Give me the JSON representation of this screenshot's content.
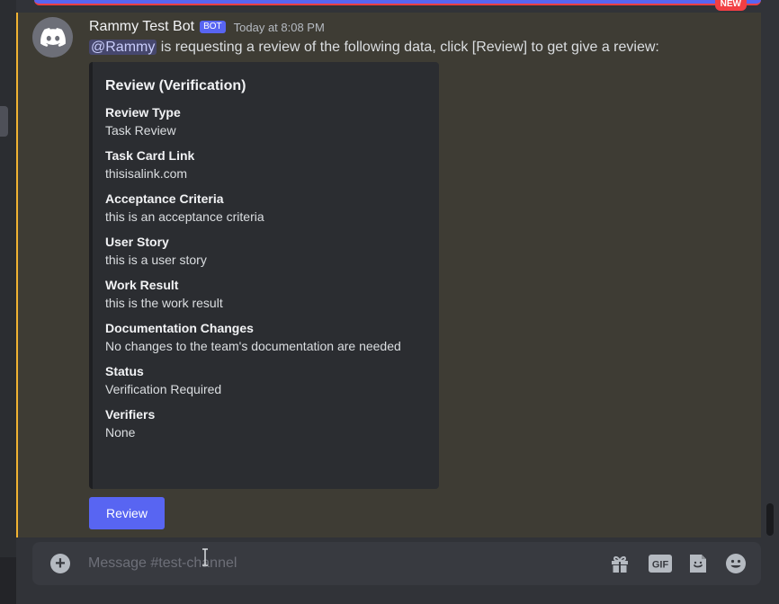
{
  "new_badge": "NEW",
  "message": {
    "username": "Rammy Test Bot",
    "bot_tag": "BOT",
    "timestamp": "Today at 8:08 PM",
    "mention": "@Rammy",
    "text": " is requesting a review of the following data, click [Review] to get give a review:"
  },
  "embed": {
    "title": "Review (Verification)",
    "fields": [
      {
        "name": "Review Type",
        "value": "Task Review"
      },
      {
        "name": "Task Card Link",
        "value": "thisisalink.com"
      },
      {
        "name": "Acceptance Criteria",
        "value": "this is an acceptance criteria"
      },
      {
        "name": "User Story",
        "value": "this is a user story"
      },
      {
        "name": "Work Result",
        "value": "this is the work result"
      },
      {
        "name": "Documentation Changes",
        "value": "No changes to the team's documentation are needed"
      },
      {
        "name": "Status",
        "value": "Verification Required"
      },
      {
        "name": "Verifiers",
        "value": "None"
      }
    ]
  },
  "review_button": "Review",
  "composer": {
    "placeholder": "Message #test-channel",
    "plus_icon": "+",
    "gif_label": "GIF"
  },
  "colors": {
    "accent": "#5865f2",
    "highlight_border": "#f0b232",
    "new_indicator": "#f23f43"
  }
}
